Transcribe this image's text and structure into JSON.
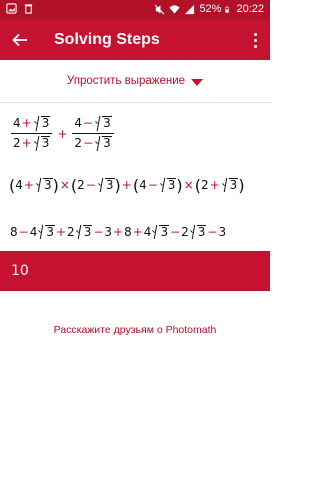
{
  "status_bar": {
    "battery": "52%",
    "time": "20:22"
  },
  "app_bar": {
    "title": "Solving Steps"
  },
  "dropdown": {
    "label": "Упростить выражение"
  },
  "steps": {
    "fraction_1": {
      "num_a": "4",
      "num_op": "+",
      "num_b": "3",
      "den_a": "2",
      "den_op": "+",
      "den_b": "3"
    },
    "plus": "+",
    "fraction_2": {
      "num_a": "4",
      "num_op": "−",
      "num_b": "3",
      "den_a": "2",
      "den_op": "−",
      "den_b": "3"
    },
    "line2": {
      "g1": [
        "4",
        "+",
        "3"
      ],
      "times1": "×",
      "g2": [
        "2",
        "−",
        "3"
      ],
      "plus": "+",
      "g3": [
        "4",
        "−",
        "3"
      ],
      "times2": "×",
      "g4": [
        "2",
        "+",
        "3"
      ]
    },
    "line3": {
      "t1": "8",
      "o1": "−",
      "t2": "4",
      "r2": "3",
      "o2": "+",
      "t3": "2",
      "r3": "3",
      "o3": "−",
      "t4": "3",
      "o4": "+",
      "t5": "8",
      "o5": "+",
      "t6": "4",
      "r6": "3",
      "o6": "−",
      "t7": "2",
      "r7": "3",
      "o7": "−",
      "t8": "3"
    }
  },
  "answer": {
    "value": "10"
  },
  "share": {
    "label": "Расскажите друзьям о Photomath"
  },
  "colors": {
    "primary": "#c41230",
    "status": "#b3112a"
  }
}
